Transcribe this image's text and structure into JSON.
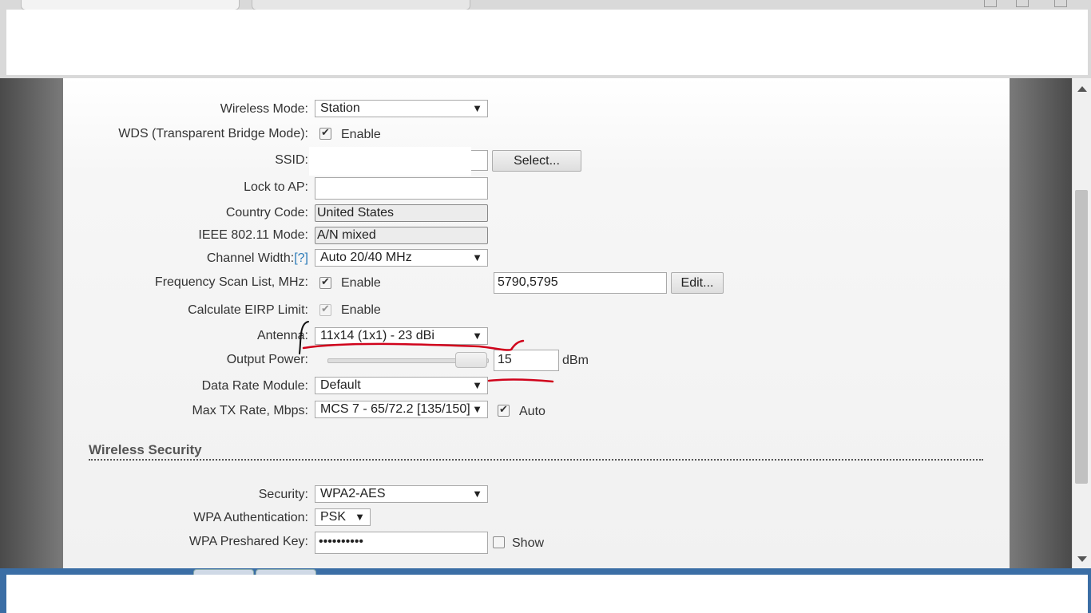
{
  "form": {
    "wireless_mode": {
      "label": "Wireless Mode:",
      "value": "Station"
    },
    "wds": {
      "label": "WDS (Transparent Bridge Mode):",
      "checkbox_label": "Enable",
      "checked": true
    },
    "ssid": {
      "label": "SSID:",
      "value": "",
      "button": "Select..."
    },
    "lock_to_ap": {
      "label": "Lock to AP:",
      "value": ""
    },
    "country_code": {
      "label": "Country Code:",
      "value": "United States"
    },
    "ieee_mode": {
      "label": "IEEE 802.11 Mode:",
      "value": "A/N mixed"
    },
    "channel_width": {
      "label": "Channel Width:",
      "help": "[?]",
      "value": "Auto 20/40 MHz"
    },
    "freq_scan": {
      "label": "Frequency Scan List, MHz:",
      "checkbox_label": "Enable",
      "checked": true,
      "value": "5790,5795",
      "button": "Edit..."
    },
    "eirp": {
      "label": "Calculate EIRP Limit:",
      "checkbox_label": "Enable",
      "checked": true
    },
    "antenna": {
      "label": "Antenna:",
      "value": "11x14 (1x1) - 23 dBi"
    },
    "output_power": {
      "label": "Output Power:",
      "value": "15",
      "unit": "dBm",
      "slider_fraction": 1.0
    },
    "data_rate_module": {
      "label": "Data Rate Module:",
      "value": "Default"
    },
    "max_tx_rate": {
      "label": "Max TX Rate, Mbps:",
      "value": "MCS 7 - 65/72.2 [135/150]",
      "checkbox_label": "Auto",
      "checked": true
    }
  },
  "security_section": {
    "title": "Wireless Security",
    "security": {
      "label": "Security:",
      "value": "WPA2-AES"
    },
    "wpa_auth": {
      "label": "WPA Authentication:",
      "value": "PSK"
    },
    "wpa_key": {
      "label": "WPA Preshared Key:",
      "value": "••••••••••",
      "checkbox_label": "Show",
      "checked": false
    }
  },
  "icons": {
    "dropdown": "▼"
  },
  "colors": {
    "annotation": "#d0021b",
    "help_link": "#2a7ab8"
  }
}
